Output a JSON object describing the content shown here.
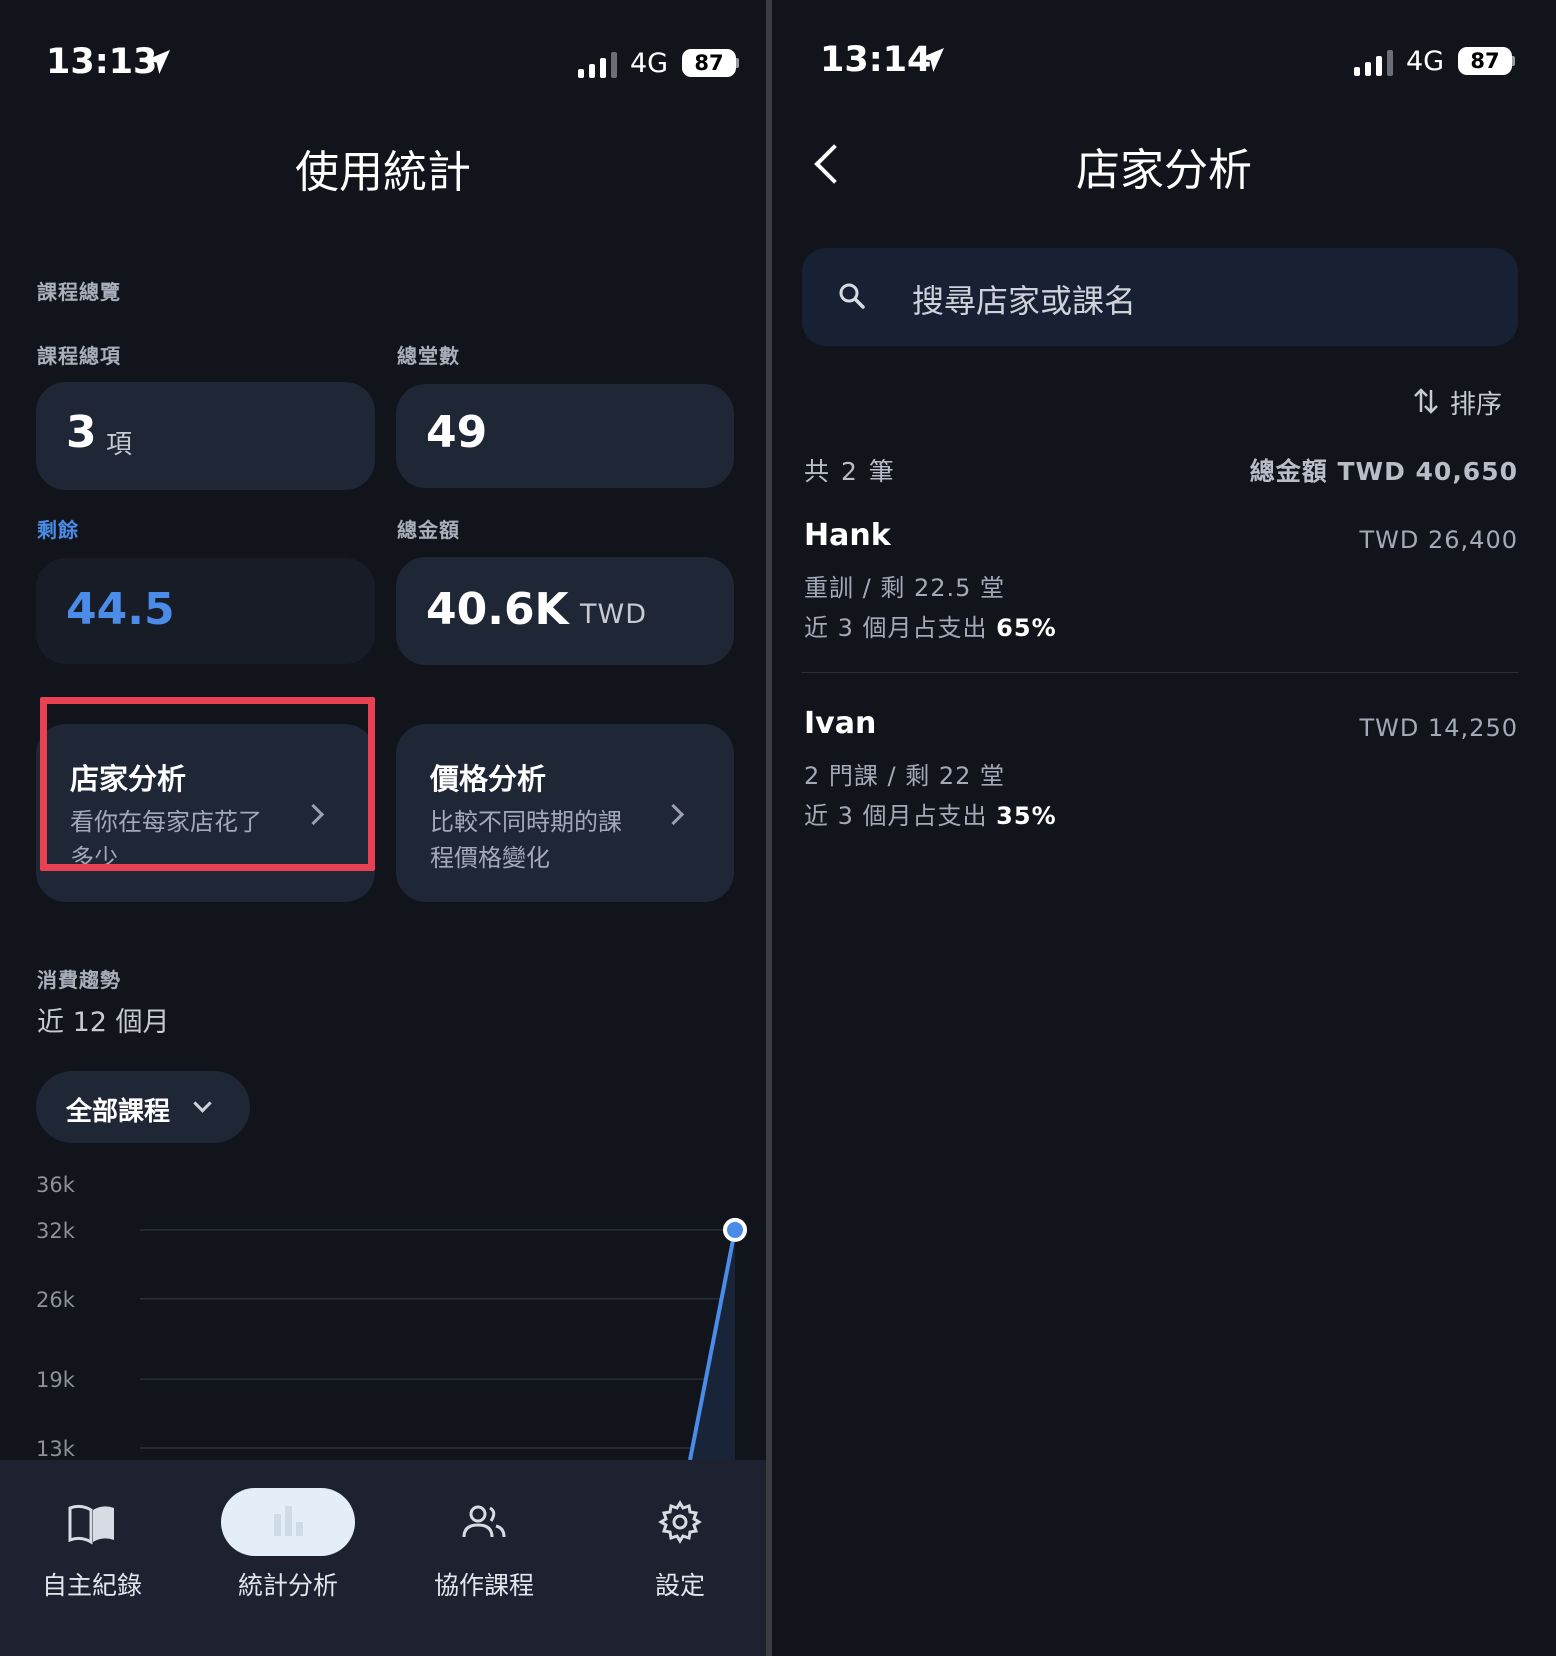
{
  "left": {
    "status": {
      "time": "13:13",
      "network": "4G",
      "battery": "87"
    },
    "title": "使用統計",
    "overview_section": "課程總覽",
    "stats": {
      "courses_label": "課程總項",
      "courses_value": "3",
      "courses_unit": "項",
      "sessions_label": "總堂數",
      "sessions_value": "49",
      "remaining_label": "剩餘",
      "remaining_value": "44.5",
      "amount_label": "總金額",
      "amount_value": "40.6K",
      "amount_unit": "TWD"
    },
    "features": [
      {
        "title": "店家分析",
        "desc_line1": "看你在每家店花了",
        "desc_line2": "多少"
      },
      {
        "title": "價格分析",
        "desc_line1": "比較不同時期的課",
        "desc_line2": "程價格變化"
      }
    ],
    "trend_section": "消費趨勢",
    "trend_range": "近 12 個月",
    "filter_selected": "全部課程",
    "chart_data": {
      "type": "line",
      "y_ticks": [
        "36k",
        "32k",
        "26k",
        "19k",
        "13k"
      ],
      "last_point_value": 32000,
      "note_visible_range": [
        13000,
        36000
      ]
    },
    "tabs": [
      {
        "label": "自主紀錄",
        "icon": "book-icon"
      },
      {
        "label": "統計分析",
        "icon": "bar-chart-icon",
        "active": true
      },
      {
        "label": "協作課程",
        "icon": "people-icon"
      },
      {
        "label": "設定",
        "icon": "gear-icon"
      }
    ]
  },
  "right": {
    "status": {
      "time": "13:14",
      "network": "4G",
      "battery": "87"
    },
    "title": "店家分析",
    "search_placeholder": "搜尋店家或課名",
    "sort_label": "排序",
    "count_label": "共 2 筆",
    "total_label": "總金額 TWD 40,650",
    "stores": [
      {
        "name": "Hank",
        "amount": "TWD 26,400",
        "line1": "重訓 / 剩 22.5 堂",
        "line2_prefix": "近 3 個月占支出",
        "pct": "65%"
      },
      {
        "name": "Ivan",
        "amount": "TWD 14,250",
        "line1": "2 門課 / 剩 22 堂",
        "line2_prefix": "近 3 個月占支出",
        "pct": "35%"
      }
    ]
  },
  "colors": {
    "accent": "#4a8ce8",
    "highlight": "#e84152",
    "bg": "#12141b",
    "card": "#1f2636"
  }
}
